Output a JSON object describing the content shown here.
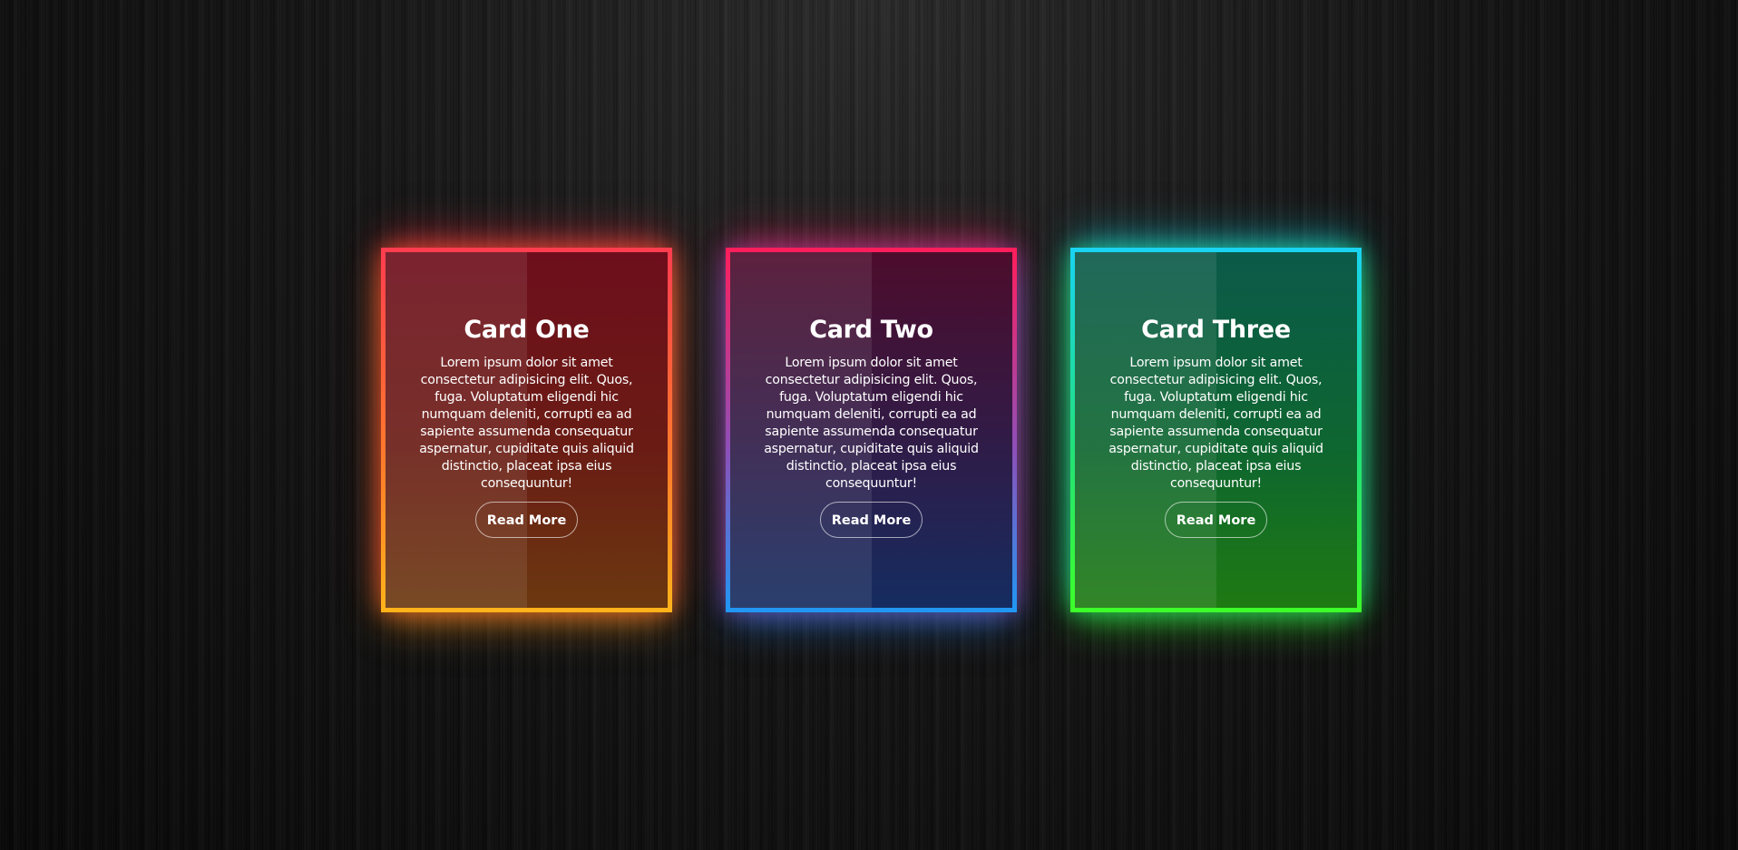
{
  "cards": [
    {
      "title": "Card One",
      "text": "Lorem ipsum dolor sit amet consectetur adipisicing elit. Quos, fuga. Voluptatum eligendi hic numquam deleniti, corrupti ea ad sapiente assumenda consequatur aspernatur, cupiditate quis aliquid distinctio, placeat ipsa eius consequuntur!",
      "button": "Read More",
      "glow_colors": [
        "#ff3d4f",
        "#ff7d2a",
        "#ffb21a"
      ]
    },
    {
      "title": "Card Two",
      "text": "Lorem ipsum dolor sit amet consectetur adipisicing elit. Quos, fuga. Voluptatum eligendi hic numquam deleniti, corrupti ea ad sapiente assumenda consequatur aspernatur, cupiditate quis aliquid distinctio, placeat ipsa eius consequuntur!",
      "button": "Read More",
      "glow_colors": [
        "#ff1e5c",
        "#8e4fb8",
        "#2196f3"
      ]
    },
    {
      "title": "Card Three",
      "text": "Lorem ipsum dolor sit amet consectetur adipisicing elit. Quos, fuga. Voluptatum eligendi hic numquam deleniti, corrupti ea ad sapiente assumenda consequatur aspernatur, cupiditate quis aliquid distinctio, placeat ipsa eius consequuntur!",
      "button": "Read More",
      "glow_colors": [
        "#19d3f0",
        "#23e07a",
        "#3dff2a"
      ]
    }
  ]
}
